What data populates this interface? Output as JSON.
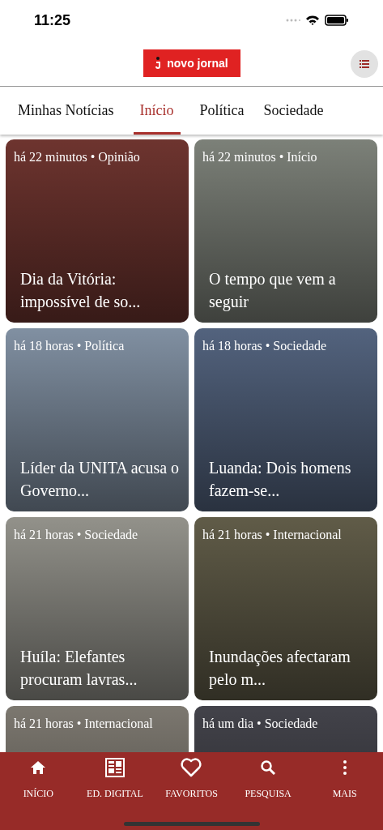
{
  "status_bar": {
    "time": "11:25"
  },
  "header": {
    "logo_text": "novo jornal"
  },
  "tabs": [
    {
      "label": "Minhas Notícias",
      "selected": false
    },
    {
      "label": "Início",
      "selected": true
    },
    {
      "label": "Política",
      "selected": false
    },
    {
      "label": "Sociedade",
      "selected": false
    }
  ],
  "articles": [
    {
      "meta": "há 22 minutos • Opinião",
      "title": "Dia da Vitória: impossível de so..."
    },
    {
      "meta": "há 22 minutos • Início",
      "title": "O tempo que vem a seguir"
    },
    {
      "meta": "há 18 horas • Política",
      "title": "Líder da UNITA acusa o Governo..."
    },
    {
      "meta": "há 18 horas • Sociedade",
      "title": "Luanda: Dois homens fazem-se..."
    },
    {
      "meta": "há 21 horas • Sociedade",
      "title": "Huíla: Elefantes procuram lavras..."
    },
    {
      "meta": "há 21 horas • Internacional",
      "title": "Inundações afectaram pelo m..."
    },
    {
      "meta": "há 21 horas • Internacional"
    },
    {
      "meta": "há um dia • Sociedade"
    }
  ],
  "bottom_nav": [
    {
      "kind": "home",
      "label": "INÍCIO"
    },
    {
      "kind": "digital",
      "label": "ED. DIGITAL"
    },
    {
      "kind": "favorites",
      "label": "FAVORITOS"
    },
    {
      "kind": "search",
      "label": "PESQUISA"
    },
    {
      "kind": "more",
      "label": "MAIS"
    }
  ]
}
